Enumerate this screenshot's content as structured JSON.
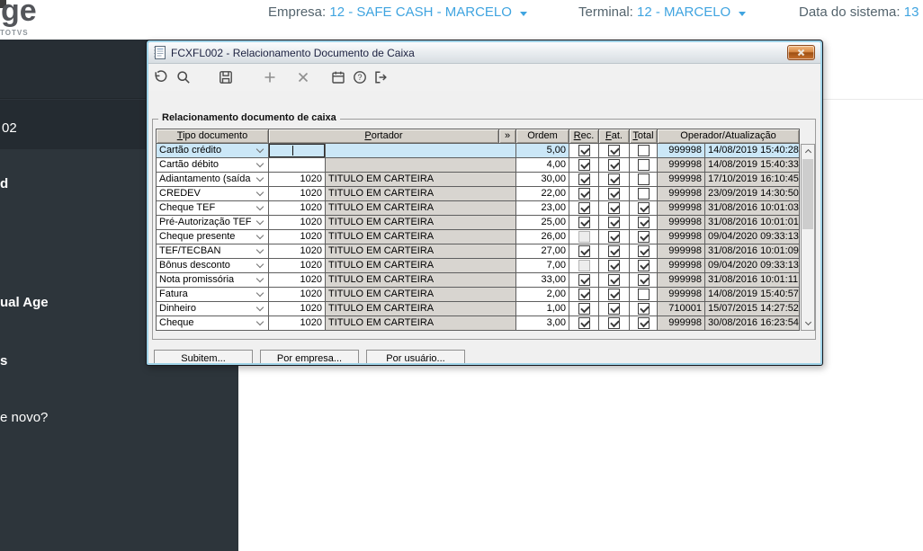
{
  "top_bar": {
    "logo_text": "ge",
    "logo_subtext": "TOTVS",
    "empresa_label": "Empresa:",
    "empresa_value": "12 - SAFE CASH - MARCELO",
    "terminal_label": "Terminal:",
    "terminal_value": "12 - MARCELO",
    "data_label": "Data do sistema:",
    "data_value": "13",
    "accent_color": "#3fa4e0"
  },
  "sidebar": {
    "bg_color": "#2d353b",
    "items": [
      "02",
      "d",
      "ual Age",
      "s",
      "e novo?"
    ]
  },
  "dialog": {
    "title": "FCXFL002 - Relacionamento Documento de Caixa",
    "toolbar_icons": [
      "undo-icon",
      "search-icon",
      "save-icon",
      "add-icon",
      "delete-icon",
      "calendar-icon",
      "help-icon",
      "exit-icon"
    ],
    "groupbox_label": "Relacionamento documento de caixa",
    "grid": {
      "selected_row_color": "#cbe7f7",
      "columns": [
        {
          "label": "Tipo documento",
          "hotkey": true
        },
        {
          "label": "Portador",
          "hotkey": true
        },
        {
          "label": "»",
          "hotkey": false
        },
        {
          "label": "Ordem",
          "hotkey": false
        },
        {
          "label": "Rec.",
          "hotkey": true
        },
        {
          "label": "Fat.",
          "hotkey": true
        },
        {
          "label": "Total",
          "hotkey": true
        },
        {
          "label": "Operador/Atualização",
          "hotkey": false
        }
      ],
      "rows": [
        {
          "tipo": "Cartão crédito",
          "codigo": "",
          "portador": "",
          "ordem": "5,00",
          "rec": "checked",
          "fat": "checked",
          "total": "empty",
          "operador": "999998",
          "atualizacao": "14/08/2019 15:40:28",
          "selected": true
        },
        {
          "tipo": "Cartão débito",
          "codigo": "",
          "portador": "",
          "ordem": "4,00",
          "rec": "checked",
          "fat": "checked",
          "total": "empty",
          "operador": "999998",
          "atualizacao": "14/08/2019 15:40:33",
          "selected": false
        },
        {
          "tipo": "Adiantamento (saída",
          "codigo": "1020",
          "portador": "TITULO EM CARTEIRA",
          "ordem": "30,00",
          "rec": "checked",
          "fat": "checked",
          "total": "empty",
          "operador": "999998",
          "atualizacao": "17/10/2019 16:10:45",
          "selected": false
        },
        {
          "tipo": "CREDEV",
          "codigo": "1020",
          "portador": "TITULO EM CARTEIRA",
          "ordem": "22,00",
          "rec": "checked",
          "fat": "checked",
          "total": "empty",
          "operador": "999998",
          "atualizacao": "23/09/2019 14:30:50",
          "selected": false
        },
        {
          "tipo": "Cheque TEF",
          "codigo": "1020",
          "portador": "TITULO EM CARTEIRA",
          "ordem": "23,00",
          "rec": "checked",
          "fat": "checked",
          "total": "checked",
          "operador": "999998",
          "atualizacao": "31/08/2016 10:01:03",
          "selected": false
        },
        {
          "tipo": "Pré-Autorização TEF",
          "codigo": "1020",
          "portador": "TITULO EM CARTEIRA",
          "ordem": "25,00",
          "rec": "checked",
          "fat": "checked",
          "total": "checked",
          "operador": "999998",
          "atualizacao": "31/08/2016 10:01:01",
          "selected": false
        },
        {
          "tipo": "Cheque presente",
          "codigo": "1020",
          "portador": "TITULO EM CARTEIRA",
          "ordem": "26,00",
          "rec": "disabled",
          "fat": "checked",
          "total": "checked",
          "operador": "999998",
          "atualizacao": "09/04/2020 09:33:13",
          "selected": false
        },
        {
          "tipo": "TEF/TECBAN",
          "codigo": "1020",
          "portador": "TITULO EM CARTEIRA",
          "ordem": "27,00",
          "rec": "checked",
          "fat": "checked",
          "total": "checked",
          "operador": "999998",
          "atualizacao": "31/08/2016 10:01:09",
          "selected": false
        },
        {
          "tipo": "Bônus desconto",
          "codigo": "1020",
          "portador": "TITULO EM CARTEIRA",
          "ordem": "7,00",
          "rec": "disabled",
          "fat": "checked",
          "total": "checked",
          "operador": "999998",
          "atualizacao": "09/04/2020 09:33:13",
          "selected": false
        },
        {
          "tipo": "Nota promissória",
          "codigo": "1020",
          "portador": "TITULO EM CARTEIRA",
          "ordem": "33,00",
          "rec": "checked",
          "fat": "checked",
          "total": "checked",
          "operador": "999998",
          "atualizacao": "31/08/2016 10:01:11",
          "selected": false
        },
        {
          "tipo": "Fatura",
          "codigo": "1020",
          "portador": "TITULO EM CARTEIRA",
          "ordem": "2,00",
          "rec": "checked",
          "fat": "checked",
          "total": "empty",
          "operador": "999998",
          "atualizacao": "14/08/2019 15:40:57",
          "selected": false
        },
        {
          "tipo": "Dinheiro",
          "codigo": "1020",
          "portador": "TITULO EM CARTEIRA",
          "ordem": "1,00",
          "rec": "checked",
          "fat": "checked",
          "total": "checked",
          "operador": "710001",
          "atualizacao": "15/07/2015 14:27:52",
          "selected": false
        },
        {
          "tipo": "Cheque",
          "codigo": "1020",
          "portador": "TITULO EM CARTEIRA",
          "ordem": "3,00",
          "rec": "checked",
          "fat": "checked",
          "total": "checked",
          "operador": "999998",
          "atualizacao": "30/08/2016 16:23:54",
          "selected": false
        }
      ]
    },
    "action_buttons": [
      "Subitem...",
      "Por empresa...",
      "Por usuário..."
    ]
  }
}
